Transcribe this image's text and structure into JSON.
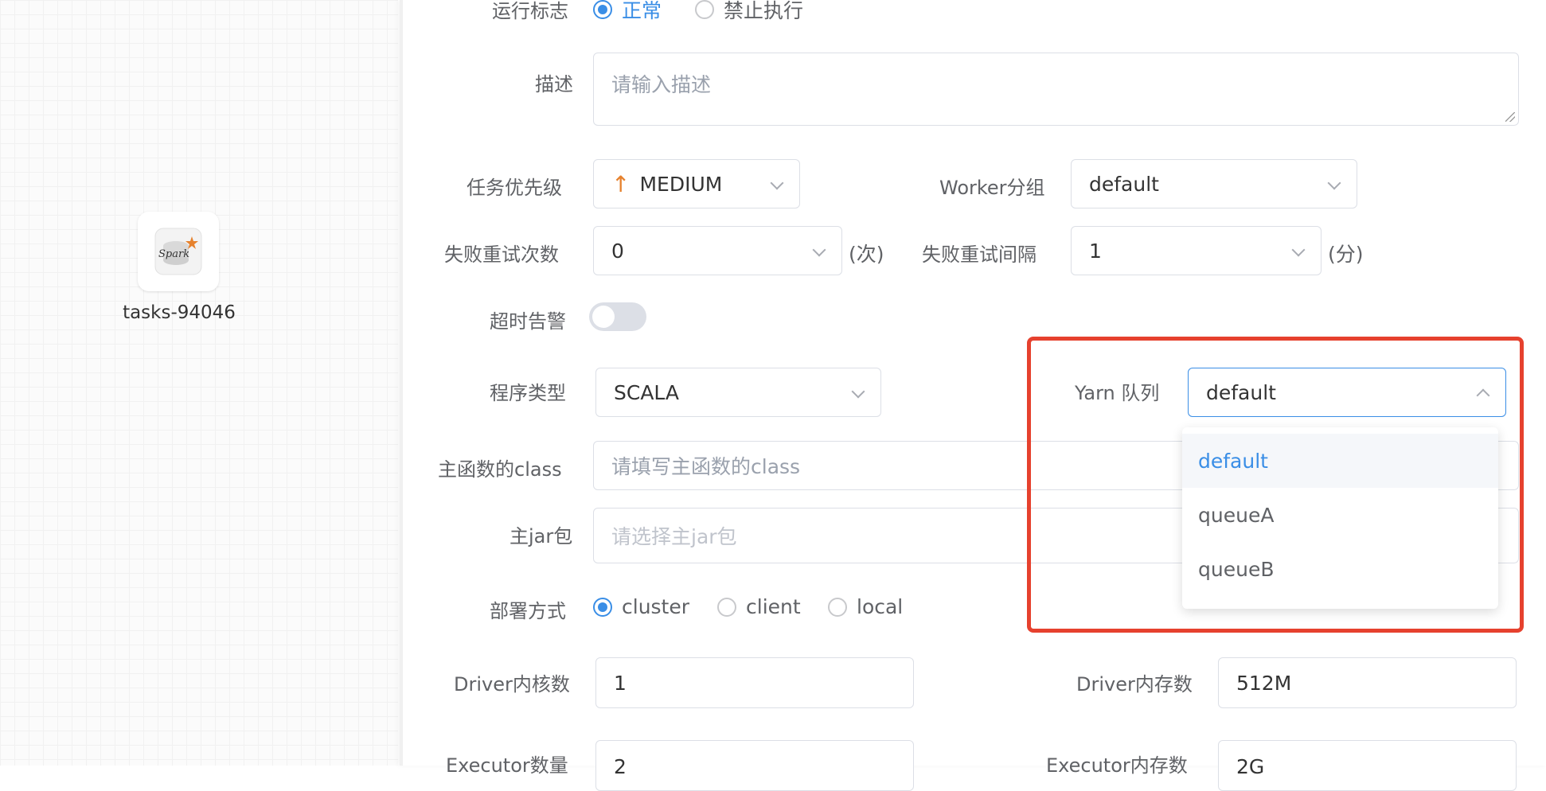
{
  "canvas": {
    "task_node_label": "tasks-94046",
    "task_node_icon": "spark-logo-icon"
  },
  "form": {
    "run_flag": {
      "label": "运行标志",
      "options": [
        "正常",
        "禁止执行"
      ],
      "selected": "正常"
    },
    "description": {
      "label": "描述",
      "placeholder": "请输入描述"
    },
    "priority": {
      "label": "任务优先级",
      "value": "MEDIUM",
      "icon": "arrow-up-icon"
    },
    "worker_group": {
      "label": "Worker分组",
      "value": "default"
    },
    "fail_retry_times": {
      "label": "失败重试次数",
      "value": "0",
      "suffix": "(次)"
    },
    "fail_retry_interval": {
      "label": "失败重试间隔",
      "value": "1",
      "suffix": "(分)"
    },
    "timeout_alarm": {
      "label": "超时告警",
      "enabled": false
    },
    "program_type": {
      "label": "程序类型",
      "value": "SCALA"
    },
    "yarn_queue": {
      "label": "Yarn 队列",
      "value": "default",
      "options": [
        "default",
        "queueA",
        "queueB"
      ]
    },
    "main_class": {
      "label": "主函数的class",
      "placeholder": "请填写主函数的class"
    },
    "main_jar": {
      "label": "主jar包",
      "placeholder": "请选择主jar包"
    },
    "deploy_mode": {
      "label": "部署方式",
      "options": [
        "cluster",
        "client",
        "local"
      ],
      "selected": "cluster"
    },
    "driver_cores": {
      "label": "Driver内核数",
      "value": "1"
    },
    "driver_memory": {
      "label": "Driver内存数",
      "value": "512M"
    },
    "executor_num": {
      "label": "Executor数量",
      "value": "2"
    },
    "executor_memory": {
      "label": "Executor内存数",
      "value": "2G"
    }
  },
  "colors": {
    "accent": "#3a8ee6",
    "highlight": "#e6412e",
    "priority_arrow": "#e6822e"
  }
}
